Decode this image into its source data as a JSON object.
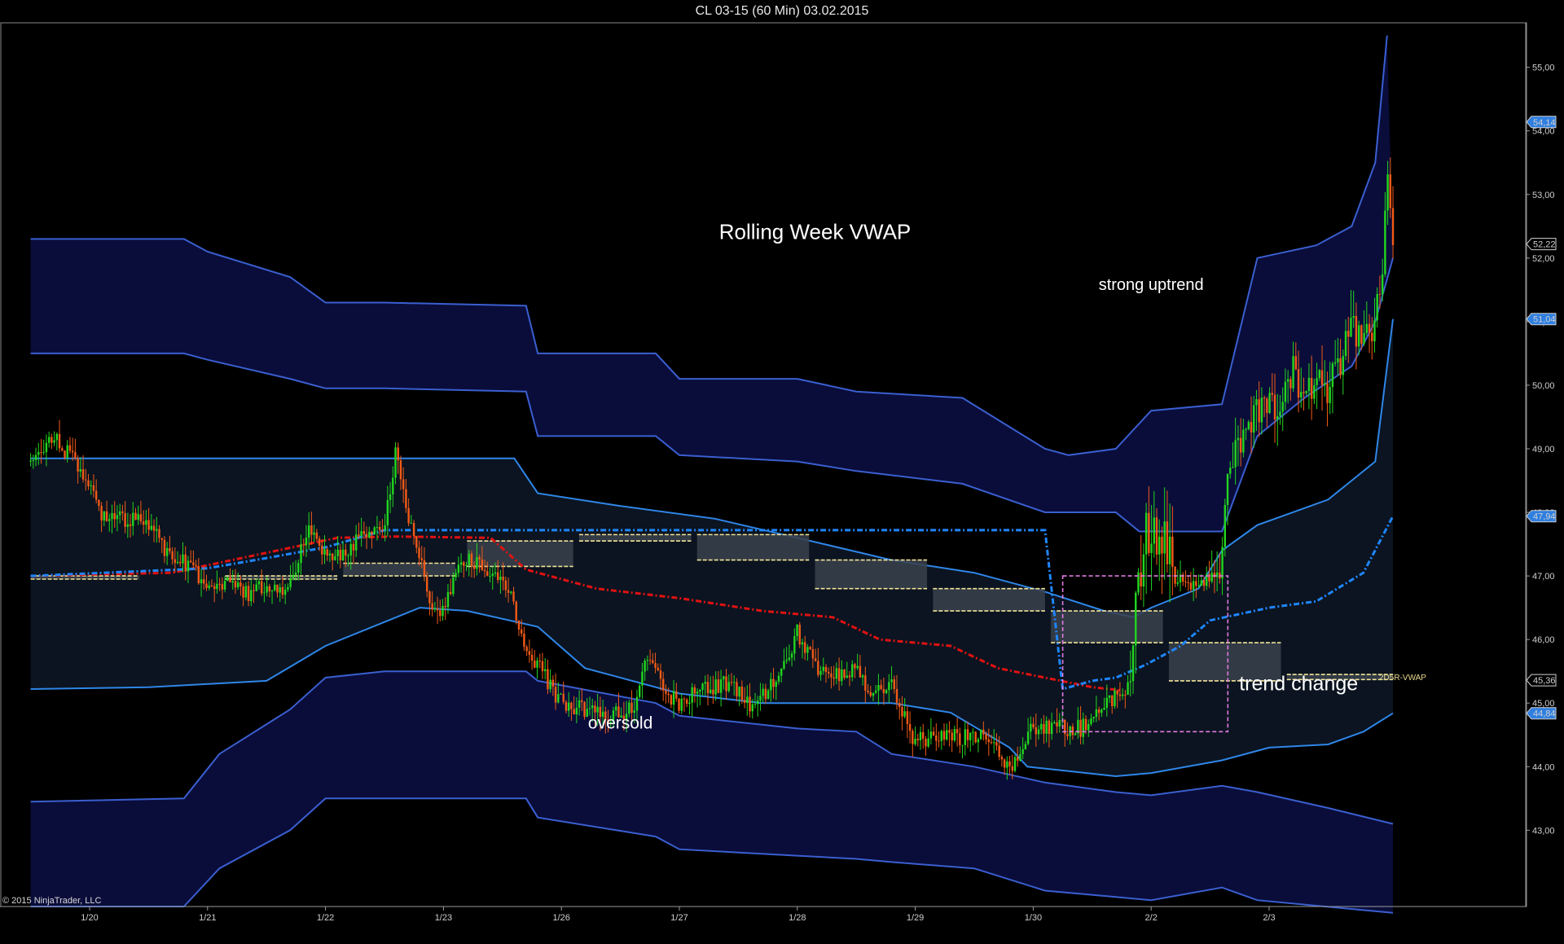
{
  "window": {
    "title": "CL 03-15 (60 Min)  03.02.2015"
  },
  "copyright": "© 2015 NinjaTrader, LLC",
  "colors": {
    "background": "#000000",
    "outer_band_fill": "#0a0d3a",
    "inner_band_fill": "#0b1420",
    "outer_band_line": "#3a5fd0",
    "inner_band_line": "#2f86e8",
    "vwap_line": "#1f86ff",
    "prior_vwap_line": "#e11212",
    "up_candle": "#22d61f",
    "down_candle": "#f25a17",
    "value_zone": "#3a414c",
    "value_zone_edge": "#f2e59a",
    "highlight_box": "#e07ae0"
  },
  "chart_data": {
    "type": "candlestick",
    "title": "Rolling Week VWAP",
    "x_tick_labels": [
      "1/20",
      "1/21",
      "1/22",
      "1/23",
      "1/26",
      "1/27",
      "1/28",
      "1/29",
      "1/30",
      "2/2",
      "2/3"
    ],
    "y_tick_labels": [
      "43,00",
      "44,00",
      "45,00",
      "46,00",
      "47,00",
      "48,00",
      "49,00",
      "50,00",
      "51,00",
      "52,00",
      "53,00",
      "54,00",
      "55,00"
    ],
    "y_ticks": [
      43,
      44,
      45,
      46,
      47,
      48,
      49,
      50,
      51,
      52,
      53,
      54,
      55
    ],
    "ylim": [
      41.8,
      55.7
    ],
    "x_days": 11.95,
    "price_markers": [
      {
        "label": "54,14",
        "value": 54.14
      },
      {
        "label": "52,22",
        "value": 52.22
      },
      {
        "label": "51,04",
        "value": 51.04
      },
      {
        "label": "47,94",
        "value": 47.94
      },
      {
        "label": "45,36",
        "value": 45.36
      },
      {
        "label": "44,84",
        "value": 44.84
      }
    ],
    "right_labels": [
      {
        "text": "2D5R-VWAP",
        "value": 45.4
      }
    ],
    "annotations": [
      {
        "text": "Rolling Week VWAP",
        "x": 6.65,
        "y": 52.3,
        "size": 26
      },
      {
        "text": "strong uptrend",
        "x": 9.5,
        "y": 51.5,
        "size": 20
      },
      {
        "text": "oversold",
        "x": 5.0,
        "y": 44.6,
        "size": 21
      },
      {
        "text": "trend change",
        "x": 10.75,
        "y": 45.2,
        "size": 25
      }
    ],
    "series": {
      "vwap": [
        [
          0,
          47.0
        ],
        [
          1,
          47.08
        ],
        [
          1.5,
          47.12
        ],
        [
          2,
          47.28
        ],
        [
          2.5,
          47.45
        ],
        [
          3,
          47.72
        ],
        [
          4,
          47.72
        ],
        [
          5,
          47.72
        ],
        [
          6,
          47.72
        ],
        [
          7,
          47.72
        ],
        [
          8,
          47.72
        ],
        [
          8.6,
          47.72
        ],
        [
          8.75,
          45.22
        ],
        [
          9.0,
          45.35
        ],
        [
          9.2,
          45.4
        ],
        [
          9.45,
          45.6
        ],
        [
          9.75,
          45.9
        ],
        [
          10.0,
          46.3
        ],
        [
          10.5,
          46.5
        ],
        [
          10.9,
          46.6
        ],
        [
          11.3,
          47.05
        ],
        [
          11.55,
          47.94
        ]
      ],
      "prior_vwap": [
        [
          0,
          47.0
        ],
        [
          1.2,
          47.05
        ],
        [
          2.6,
          47.6
        ],
        [
          3.1,
          47.62
        ],
        [
          3.9,
          47.6
        ],
        [
          4.2,
          47.1
        ],
        [
          4.8,
          46.8
        ],
        [
          5.5,
          46.65
        ],
        [
          6.2,
          46.45
        ],
        [
          6.8,
          46.35
        ],
        [
          7.2,
          46.0
        ],
        [
          7.8,
          45.9
        ],
        [
          8.2,
          45.55
        ],
        [
          8.6,
          45.4
        ],
        [
          9.0,
          45.25
        ],
        [
          9.25,
          45.2
        ]
      ],
      "inner_upper": [
        [
          0,
          48.85
        ],
        [
          1,
          48.85
        ],
        [
          3,
          48.85
        ],
        [
          4.1,
          48.85
        ],
        [
          4.3,
          48.3
        ],
        [
          5,
          48.1
        ],
        [
          5.8,
          47.9
        ],
        [
          6.5,
          47.6
        ],
        [
          7.3,
          47.25
        ],
        [
          8,
          47.05
        ],
        [
          8.6,
          46.75
        ],
        [
          9.1,
          46.45
        ],
        [
          9.35,
          46.35
        ],
        [
          9.5,
          46.5
        ],
        [
          9.9,
          46.8
        ],
        [
          10.1,
          47.4
        ],
        [
          10.4,
          47.8
        ],
        [
          11.0,
          48.2
        ],
        [
          11.4,
          48.8
        ],
        [
          11.55,
          51.04
        ]
      ],
      "inner_lower": [
        [
          0,
          45.22
        ],
        [
          1,
          45.25
        ],
        [
          2,
          45.35
        ],
        [
          2.5,
          45.9
        ],
        [
          3.3,
          46.5
        ],
        [
          3.7,
          46.45
        ],
        [
          4.3,
          46.2
        ],
        [
          4.7,
          45.55
        ],
        [
          5.5,
          45.15
        ],
        [
          6.2,
          45.0
        ],
        [
          7.3,
          45.0
        ],
        [
          7.8,
          44.85
        ],
        [
          8.3,
          44.3
        ],
        [
          8.45,
          44.0
        ],
        [
          9.2,
          43.85
        ],
        [
          9.5,
          43.9
        ],
        [
          10.1,
          44.1
        ],
        [
          10.5,
          44.3
        ],
        [
          11.0,
          44.35
        ],
        [
          11.3,
          44.55
        ],
        [
          11.55,
          44.84
        ]
      ],
      "outer_upper_top": [
        [
          0,
          52.3
        ],
        [
          1.3,
          52.3
        ],
        [
          1.5,
          52.1
        ],
        [
          2.2,
          51.7
        ],
        [
          2.5,
          51.3
        ],
        [
          3.0,
          51.3
        ],
        [
          4.2,
          51.25
        ],
        [
          4.3,
          50.5
        ],
        [
          5.3,
          50.5
        ],
        [
          5.5,
          50.1
        ],
        [
          6.5,
          50.1
        ],
        [
          7.0,
          49.9
        ],
        [
          7.9,
          49.8
        ],
        [
          8.6,
          49.0
        ],
        [
          8.8,
          48.9
        ],
        [
          9.2,
          49.0
        ],
        [
          9.5,
          49.6
        ],
        [
          10.1,
          49.7
        ],
        [
          10.4,
          52.0
        ],
        [
          10.9,
          52.2
        ],
        [
          11.2,
          52.5
        ],
        [
          11.4,
          53.5
        ],
        [
          11.5,
          55.5
        ]
      ],
      "outer_upper_bottom": [
        [
          0,
          50.5
        ],
        [
          1.3,
          50.5
        ],
        [
          1.5,
          50.4
        ],
        [
          2.2,
          50.1
        ],
        [
          2.5,
          49.95
        ],
        [
          3.0,
          49.95
        ],
        [
          4.2,
          49.9
        ],
        [
          4.3,
          49.2
        ],
        [
          5.3,
          49.2
        ],
        [
          5.5,
          48.9
        ],
        [
          6.5,
          48.8
        ],
        [
          7.0,
          48.65
        ],
        [
          7.9,
          48.45
        ],
        [
          8.6,
          48.0
        ],
        [
          8.8,
          48.0
        ],
        [
          9.2,
          48.0
        ],
        [
          9.4,
          47.7
        ],
        [
          10.1,
          47.7
        ],
        [
          10.4,
          49.2
        ],
        [
          10.8,
          49.8
        ],
        [
          11.2,
          50.3
        ],
        [
          11.4,
          51.0
        ],
        [
          11.55,
          52.0
        ]
      ],
      "outer_lower_top": [
        [
          0,
          43.45
        ],
        [
          1.3,
          43.5
        ],
        [
          1.6,
          44.2
        ],
        [
          2.2,
          44.9
        ],
        [
          2.5,
          45.4
        ],
        [
          3.0,
          45.5
        ],
        [
          4.2,
          45.5
        ],
        [
          4.3,
          45.35
        ],
        [
          5.3,
          45.0
        ],
        [
          5.5,
          44.8
        ],
        [
          6.5,
          44.6
        ],
        [
          7.0,
          44.55
        ],
        [
          7.3,
          44.2
        ],
        [
          8.0,
          44.0
        ],
        [
          8.6,
          43.75
        ],
        [
          9.2,
          43.6
        ],
        [
          9.5,
          43.55
        ],
        [
          10.1,
          43.7
        ],
        [
          10.4,
          43.6
        ],
        [
          11.0,
          43.35
        ],
        [
          11.55,
          43.1
        ]
      ],
      "outer_lower_bottom": [
        [
          0,
          41.8
        ],
        [
          1.3,
          41.8
        ],
        [
          1.6,
          42.4
        ],
        [
          2.2,
          43.0
        ],
        [
          2.5,
          43.5
        ],
        [
          3.0,
          43.5
        ],
        [
          4.2,
          43.5
        ],
        [
          4.3,
          43.2
        ],
        [
          5.3,
          42.9
        ],
        [
          5.5,
          42.7
        ],
        [
          6.5,
          42.6
        ],
        [
          7.0,
          42.55
        ],
        [
          7.3,
          42.5
        ],
        [
          8.0,
          42.4
        ],
        [
          8.6,
          42.05
        ],
        [
          9.2,
          41.95
        ],
        [
          9.5,
          41.9
        ],
        [
          10.1,
          42.1
        ],
        [
          10.4,
          41.9
        ],
        [
          11.55,
          41.7
        ]
      ]
    },
    "price_path": [
      [
        0,
        48.8
      ],
      [
        0.2,
        49.2
      ],
      [
        0.4,
        48.7
      ],
      [
        0.6,
        48.0
      ],
      [
        0.8,
        47.9
      ],
      [
        1.0,
        47.85
      ],
      [
        1.2,
        47.2
      ],
      [
        1.35,
        47.2
      ],
      [
        1.5,
        46.8
      ],
      [
        1.7,
        46.9
      ],
      [
        1.85,
        46.7
      ],
      [
        2.0,
        46.9
      ],
      [
        2.1,
        46.7
      ],
      [
        2.2,
        46.9
      ],
      [
        2.35,
        47.8
      ],
      [
        2.5,
        47.3
      ],
      [
        2.65,
        47.3
      ],
      [
        2.8,
        47.6
      ],
      [
        3.0,
        47.8
      ],
      [
        3.1,
        49.0
      ],
      [
        3.2,
        48.0
      ],
      [
        3.3,
        47.3
      ],
      [
        3.4,
        46.4
      ],
      [
        3.5,
        46.5
      ],
      [
        3.65,
        47.3
      ],
      [
        3.8,
        47.2
      ],
      [
        4.0,
        47.0
      ],
      [
        4.1,
        46.5
      ],
      [
        4.2,
        45.9
      ],
      [
        4.3,
        45.6
      ],
      [
        4.5,
        45.0
      ],
      [
        4.7,
        44.9
      ],
      [
        4.9,
        44.8
      ],
      [
        5.1,
        44.9
      ],
      [
        5.25,
        45.8
      ],
      [
        5.4,
        45.1
      ],
      [
        5.5,
        45.0
      ],
      [
        5.7,
        45.2
      ],
      [
        5.9,
        45.3
      ],
      [
        6.1,
        45.0
      ],
      [
        6.3,
        45.3
      ],
      [
        6.5,
        46.1
      ],
      [
        6.65,
        45.6
      ],
      [
        6.8,
        45.4
      ],
      [
        7.0,
        45.5
      ],
      [
        7.1,
        45.2
      ],
      [
        7.3,
        45.3
      ],
      [
        7.4,
        44.8
      ],
      [
        7.5,
        44.4
      ],
      [
        7.7,
        44.5
      ],
      [
        7.9,
        44.45
      ],
      [
        8.1,
        44.5
      ],
      [
        8.3,
        44.0
      ],
      [
        8.4,
        44.3
      ],
      [
        8.5,
        44.6
      ],
      [
        8.7,
        44.6
      ],
      [
        8.9,
        44.6
      ],
      [
        9.0,
        44.8
      ],
      [
        9.15,
        45.0
      ],
      [
        9.3,
        45.3
      ],
      [
        9.45,
        47.6
      ],
      [
        9.6,
        47.7
      ],
      [
        9.7,
        47.0
      ],
      [
        9.8,
        46.9
      ],
      [
        9.9,
        46.8
      ],
      [
        10.0,
        47.0
      ],
      [
        10.1,
        47.2
      ],
      [
        10.15,
        48.8
      ],
      [
        10.25,
        49.0
      ],
      [
        10.35,
        49.5
      ],
      [
        10.5,
        49.8
      ],
      [
        10.6,
        49.6
      ],
      [
        10.7,
        50.2
      ],
      [
        10.8,
        49.9
      ],
      [
        10.9,
        50.1
      ],
      [
        11.0,
        49.9
      ],
      [
        11.1,
        50.4
      ],
      [
        11.2,
        50.9
      ],
      [
        11.35,
        50.7
      ],
      [
        11.45,
        51.5
      ],
      [
        11.5,
        53.5
      ],
      [
        11.55,
        52.2
      ]
    ],
    "value_zones": [
      {
        "x0": 0.0,
        "x1": 0.92,
        "y0": 47.0,
        "y1": 46.95
      },
      {
        "x0": 1.65,
        "x1": 2.6,
        "y0": 47.0,
        "y1": 46.95
      },
      {
        "x0": 2.65,
        "x1": 3.6,
        "y0": 47.2,
        "y1": 47.0
      },
      {
        "x0": 3.7,
        "x1": 4.6,
        "y0": 47.55,
        "y1": 47.15
      },
      {
        "x0": 4.65,
        "x1": 5.6,
        "y0": 47.65,
        "y1": 47.55
      },
      {
        "x0": 5.65,
        "x1": 6.6,
        "y0": 47.65,
        "y1": 47.25
      },
      {
        "x0": 6.65,
        "x1": 7.6,
        "y0": 47.25,
        "y1": 46.8
      },
      {
        "x0": 7.65,
        "x1": 8.6,
        "y0": 46.8,
        "y1": 46.45
      },
      {
        "x0": 8.65,
        "x1": 9.6,
        "y0": 46.45,
        "y1": 45.95
      },
      {
        "x0": 9.65,
        "x1": 10.6,
        "y0": 45.95,
        "y1": 45.35
      },
      {
        "x0": 10.65,
        "x1": 11.55,
        "y0": 45.45,
        "y1": 45.37
      }
    ],
    "highlight_box": {
      "x0": 8.75,
      "x1": 10.15,
      "y0": 47.0,
      "y1": 44.55
    }
  }
}
